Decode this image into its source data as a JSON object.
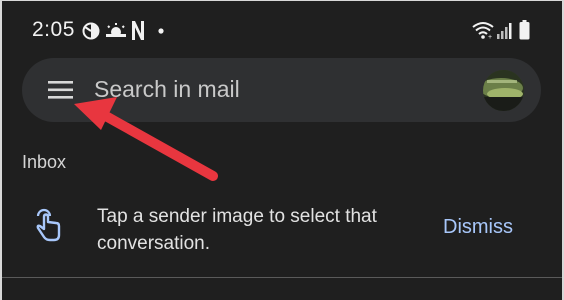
{
  "status_bar": {
    "time": "2:05",
    "notification_icons": [
      "data-saver-icon",
      "weather-icon",
      "netflix-icon",
      "dot-icon"
    ],
    "system_icons": [
      "wifi-icon",
      "signal-icon",
      "battery-icon"
    ]
  },
  "search": {
    "placeholder": "Search in mail",
    "menu_icon": "hamburger-menu-icon",
    "avatar": "account-avatar"
  },
  "annotation": {
    "arrow_color": "#e8363f",
    "points_to": "hamburger-menu-icon"
  },
  "mailbox": {
    "label": "Inbox"
  },
  "tip": {
    "icon": "touch-hand-icon",
    "text": "Tap a sender image to select that conversation.",
    "dismiss_label": "Dismiss"
  },
  "colors": {
    "background": "#1f1f1f",
    "search_bar": "#2f3032",
    "accent": "#a8c7fa"
  }
}
